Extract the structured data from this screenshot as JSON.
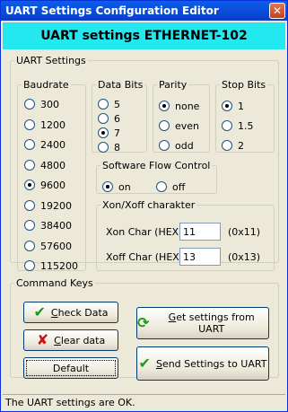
{
  "window": {
    "title": "UART Settings Configuration Editor",
    "close_glyph": "✕"
  },
  "header": {
    "title": "UART settings ETHERNET-102",
    "background": "#24e8f0"
  },
  "uart_settings": {
    "legend": "UART Settings",
    "baudrate": {
      "legend": "Baudrate",
      "options": [
        "300",
        "1200",
        "2400",
        "4800",
        "9600",
        "19200",
        "38400",
        "57600",
        "115200"
      ],
      "selected": "9600"
    },
    "data_bits": {
      "legend": "Data Bits",
      "options": [
        "5",
        "6",
        "7",
        "8"
      ],
      "selected": "7"
    },
    "parity": {
      "legend": "Parity",
      "options": [
        "none",
        "even",
        "odd"
      ],
      "selected": "none"
    },
    "stop_bits": {
      "legend": "Stop Bits",
      "options": [
        "1",
        "1.5",
        "2"
      ],
      "selected": "1"
    },
    "flow_control": {
      "legend": "Software Flow Control",
      "options": [
        "on",
        "off"
      ],
      "selected": "on"
    },
    "xon_xoff": {
      "legend": "Xon/Xoff charakter",
      "xon_label": "Xon Char (HEX)",
      "xon_value": "11",
      "xon_hint": "(0x11)",
      "xoff_label": "Xoff Char (HEX)",
      "xoff_value": "13",
      "xoff_hint": "(0x13)"
    }
  },
  "command_keys": {
    "legend": "Command Keys",
    "check_data": {
      "underline": "C",
      "rest": "heck Data",
      "icon": "check-icon",
      "color": "#1a9a1a"
    },
    "clear_data": {
      "underline": "C",
      "rest": "lear data",
      "icon": "x-icon",
      "color": "#d01010"
    },
    "default": {
      "label": "Default"
    },
    "get_settings": {
      "underline": "G",
      "rest": "et settings from UART",
      "icon": "refresh-icon",
      "color": "#1a9a1a"
    },
    "send_settings": {
      "underline": "S",
      "rest": "end Settings to UART",
      "icon": "check-icon",
      "color": "#1a9a1a"
    }
  },
  "status_bar": {
    "text": "The UART settings are OK."
  }
}
